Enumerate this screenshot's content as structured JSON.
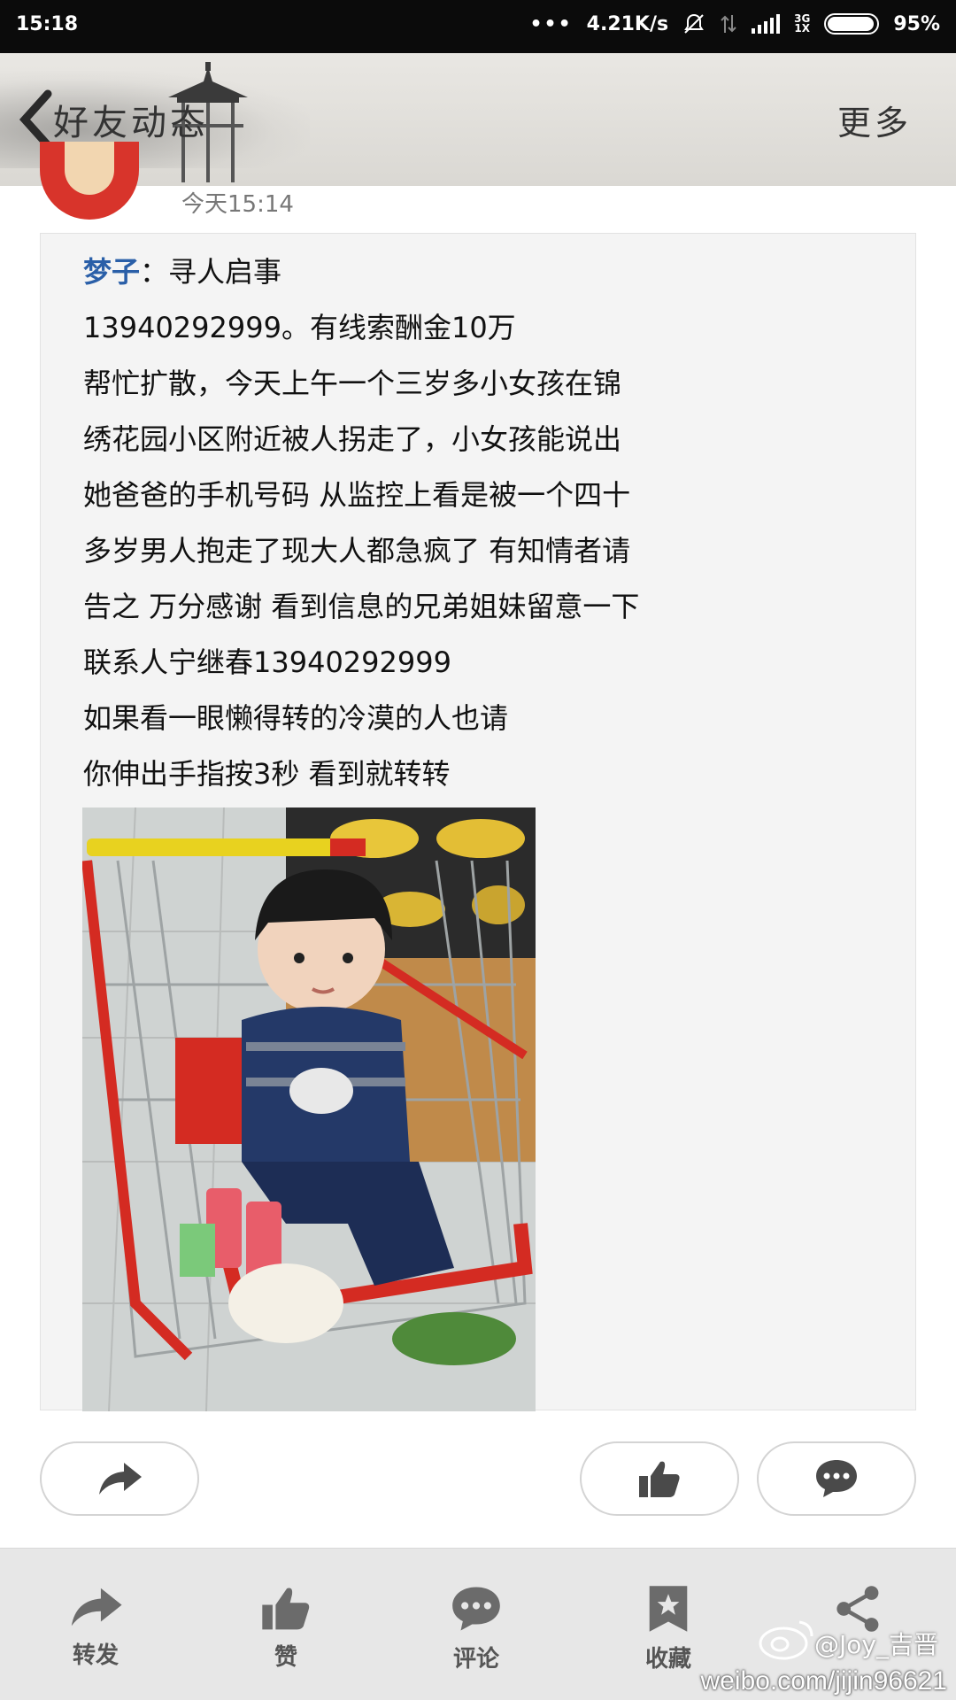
{
  "status_bar": {
    "time": "15:18",
    "dots": "•••",
    "speed": "4.21K/s",
    "network_top": "3G",
    "network_bottom": "1X",
    "battery": "95%",
    "battery_level": 0.95
  },
  "header": {
    "title": "好友动态",
    "more": "更多"
  },
  "post": {
    "time": "今天15:14",
    "author": "梦子",
    "separator": "：",
    "lines": [
      "寻人启事",
      "13940292999。有线索酬金10万",
      "帮忙扩散，今天上午一个三岁多小女孩在锦",
      "绣花园小区附近被人拐走了，小女孩能说出",
      "她爸爸的手机号码 从监控上看是被一个四十",
      "多岁男人抱走了现大人都急疯了 有知情者请",
      "告之 万分感谢 看到信息的兄弟姐妹留意一下",
      "联系人宁继春13940292999",
      "如果看一眼懒得转的冷漠的人也请",
      "你伸出手指按3秒 看到就转转"
    ]
  },
  "toolbar": {
    "items": [
      {
        "label": "转发",
        "icon": "forward-icon"
      },
      {
        "label": "赞",
        "icon": "thumbs-up-icon"
      },
      {
        "label": "评论",
        "icon": "comment-icon"
      },
      {
        "label": "收藏",
        "icon": "bookmark-icon"
      },
      {
        "label": "",
        "icon": "share-icon"
      }
    ]
  },
  "watermark": {
    "user": "@Joy_吉晋",
    "url": "weibo.com/jijin96621"
  },
  "colors": {
    "author": "#2a5fa8",
    "status_bar": "#0b0b0b",
    "toolbar_bg": "#e7e7e7"
  }
}
